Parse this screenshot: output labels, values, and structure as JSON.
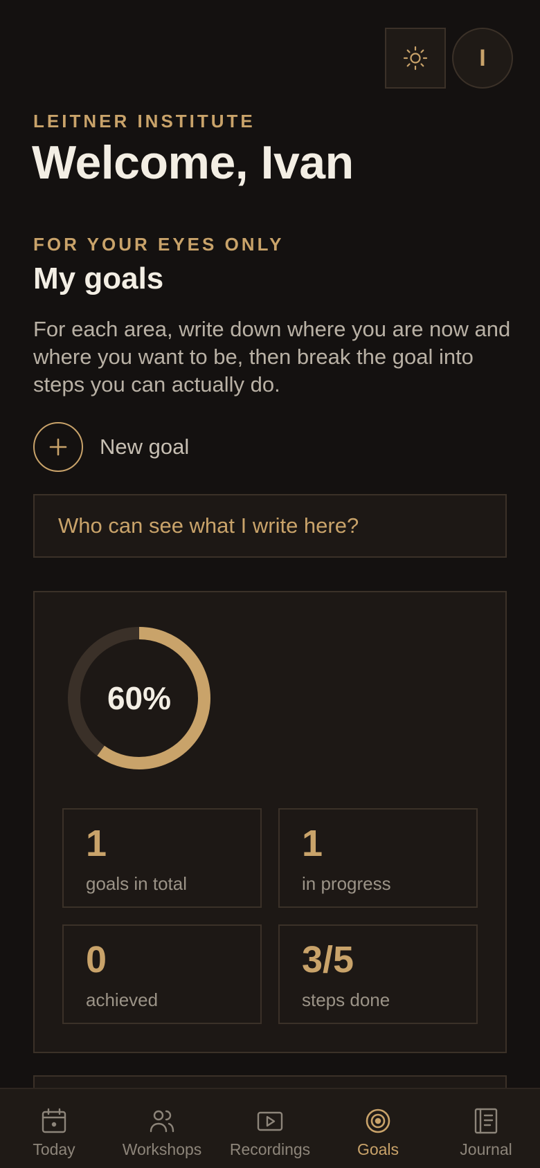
{
  "header": {
    "avatar_initial": "I",
    "theme_icon": "sun-icon"
  },
  "brand": {
    "eyebrow": "LEITNER INSTITUTE"
  },
  "welcome": {
    "title": "Welcome, Ivan"
  },
  "goals": {
    "eyebrow": "FOR YOUR EYES ONLY",
    "title": "My goals",
    "description": "For each area, write down where you are now and where you want to be, then break the goal into steps you can actually do.",
    "new_goal_label": "New goal",
    "privacy_label": "Who can see what I write here?"
  },
  "progress": {
    "percent_label": "60%",
    "fraction": 0.6
  },
  "stats": [
    {
      "value": "1",
      "label": "goals in total"
    },
    {
      "value": "1",
      "label": "in progress"
    },
    {
      "value": "0",
      "label": "achieved"
    },
    {
      "value": "3/5",
      "label": "steps done"
    }
  ],
  "nav": {
    "items": [
      {
        "label": "Today",
        "icon": "calendar-icon",
        "active": false
      },
      {
        "label": "Workshops",
        "icon": "people-icon",
        "active": false
      },
      {
        "label": "Recordings",
        "icon": "play-video-icon",
        "active": false
      },
      {
        "label": "Goals",
        "icon": "target-icon",
        "active": true
      },
      {
        "label": "Journal",
        "icon": "journal-icon",
        "active": false
      }
    ]
  },
  "colors": {
    "background": "#141110",
    "accent": "#c9a36a",
    "card": "#1d1815",
    "border": "#3b3128",
    "ring_track": "#3a3028"
  }
}
